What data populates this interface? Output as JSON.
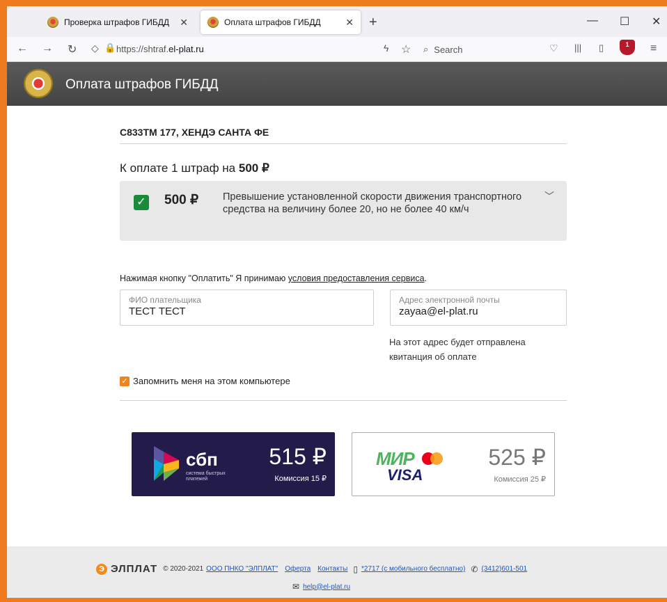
{
  "browser": {
    "tabs": [
      {
        "label": "Проверка штрафов ГИБДД",
        "active": false
      },
      {
        "label": "Оплата штрафов ГИБДД",
        "active": true
      }
    ],
    "url_prefix": "https://shtraf.",
    "url_domain": "el-plat.ru",
    "search_placeholder": "Search",
    "extension_badge": "1"
  },
  "site": {
    "title": "Оплата штрафов ГИБДД"
  },
  "order": {
    "vehicle": "С833ТМ 177, ХЕНДЭ САНТА ФЕ",
    "to_pay_prefix": "К оплате 1 штраф на ",
    "to_pay_amount": "500 ₽",
    "fine": {
      "amount": "500 ₽",
      "description": "Превышение установленной скорости движения транспортного средства на величину более 20, но не более 40 км/ч",
      "checked": true
    }
  },
  "form": {
    "terms_text": "Нажимая кнопку \"Оплатить\" Я принимаю ",
    "terms_link": "условия предоставления сервиса",
    "terms_end": ".",
    "payer_label": "ФИО плательщика",
    "payer_value": "ТЕСТ ТЕСТ",
    "email_label": "Адрес электронной почты",
    "email_value": "zayaa@el-plat.ru",
    "email_hint": "На этот адрес будет отправлена квитанция об оплате",
    "remember_label": "Запомнить меня на этом компьютере"
  },
  "payment": {
    "sbp": {
      "logo_word": "сбп",
      "logo_sub": "система быстрых платежей",
      "price": "515 ₽",
      "commission": "Комиссия 15 ₽"
    },
    "card": {
      "mir": "МИР",
      "visa": "VISA",
      "price": "525 ₽",
      "commission": "Комиссия 25 ₽"
    }
  },
  "footer": {
    "brand": "ЭЛПЛАТ",
    "copyright": "© 2020-2021",
    "company_link": "ООО ПНКО \"ЭЛПЛАТ\"",
    "offer_link": "Оферта",
    "contacts_link": "Контакты",
    "mobile_link": "*2717 (с мобильного бесплатно)",
    "phone_link": "(3412)601-501",
    "email_link": "help@el-plat.ru"
  },
  "colors": {
    "frame": "#f07a1e",
    "header": "#4d4d4d",
    "check_green": "#1c8a3b",
    "sbp_bg": "#231b4a",
    "accent_orange": "#f2841c"
  }
}
